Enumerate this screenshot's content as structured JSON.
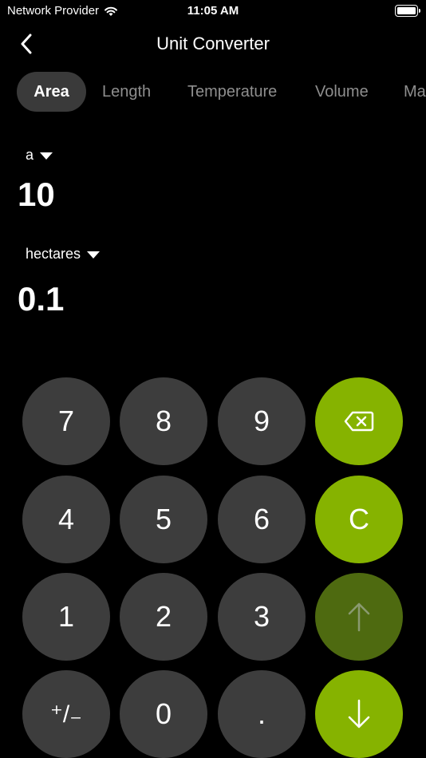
{
  "status": {
    "carrier": "Network Provider",
    "time": "11:05 AM"
  },
  "nav": {
    "title": "Unit Converter"
  },
  "tabs": [
    {
      "label": "Area",
      "active": true
    },
    {
      "label": "Length",
      "active": false
    },
    {
      "label": "Temperature",
      "active": false
    },
    {
      "label": "Volume",
      "active": false
    },
    {
      "label": "Ma",
      "active": false
    }
  ],
  "converter": {
    "from_unit": "a",
    "from_value": "10",
    "to_unit": "hectares",
    "to_value": "0.1"
  },
  "keypad": {
    "k7": "7",
    "k8": "8",
    "k9": "9",
    "k4": "4",
    "k5": "5",
    "k6": "6",
    "k1": "1",
    "k2": "2",
    "k3": "3",
    "sign": "⁺/₋",
    "k0": "0",
    "dot": ".",
    "clear": "C"
  },
  "colors": {
    "accent": "#86b300",
    "accent_dim": "#4e6a10",
    "key_bg": "#3d3d3d",
    "background": "#000000"
  }
}
